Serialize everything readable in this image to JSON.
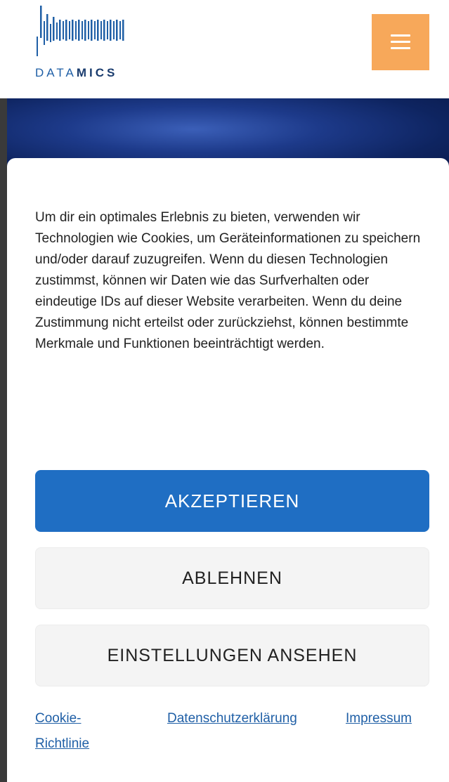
{
  "brand": {
    "logo_text_light": "DATA",
    "logo_text_bold": "MICS",
    "logo_color": "#1f5fa6",
    "logo_icon": "datamics-waveform-logo"
  },
  "header": {
    "menu_icon": "hamburger-menu-icon",
    "menu_button_color": "#f7a85a"
  },
  "consent": {
    "text": "Um dir ein optimales Erlebnis zu bieten, verwenden wir Technologien wie Cookies, um Geräteinformationen zu speichern und/oder darauf zuzugreifen. Wenn du diesen Technologien zustimmst, können wir Daten wie das Surfverhalten oder eindeutige IDs auf dieser Website verarbeiten. Wenn du deine Zustimmung nicht erteilst oder zurückziehst, können bestimmte Merkmale und Funktionen beeinträchtigt werden.",
    "accept_label": "AKZEPTIEREN",
    "deny_label": "ABLEHNEN",
    "settings_label": "EINSTELLUNGEN ANSEHEN",
    "accent_color": "#1f6ec3"
  },
  "links": {
    "cookie_policy": "Cookie-Richtlinie",
    "privacy": "Datenschutzerklärung",
    "imprint": "Impressum"
  }
}
